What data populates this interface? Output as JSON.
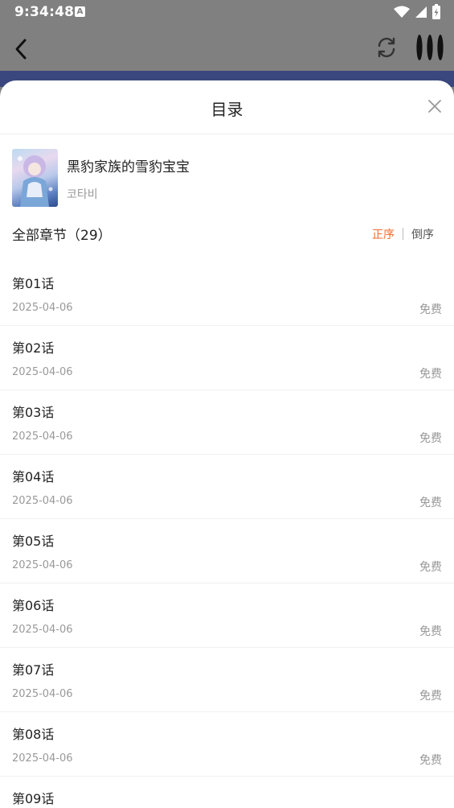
{
  "status": {
    "time": "9:34:48",
    "a_icon_text": "A"
  },
  "sheet": {
    "title": "目录"
  },
  "book": {
    "title": "黑豹家族的雪豹宝宝",
    "author": "코타비"
  },
  "chapters_header": {
    "count_label": "全部章节（29）",
    "sort_asc": "正序",
    "sort_desc": "倒序"
  },
  "chapters": [
    {
      "name": "第01话",
      "date": "2025-04-06",
      "price": "免费"
    },
    {
      "name": "第02话",
      "date": "2025-04-06",
      "price": "免费"
    },
    {
      "name": "第03话",
      "date": "2025-04-06",
      "price": "免费"
    },
    {
      "name": "第04话",
      "date": "2025-04-06",
      "price": "免费"
    },
    {
      "name": "第05话",
      "date": "2025-04-06",
      "price": "免费"
    },
    {
      "name": "第06话",
      "date": "2025-04-06",
      "price": "免费"
    },
    {
      "name": "第07话",
      "date": "2025-04-06",
      "price": "免费"
    },
    {
      "name": "第08话",
      "date": "2025-04-06",
      "price": "免费"
    },
    {
      "name": "第09话",
      "date": "",
      "price": ""
    }
  ],
  "colors": {
    "accent": "#f06a2d",
    "overlay": "#808080",
    "sheet_bg": "#ffffff"
  }
}
